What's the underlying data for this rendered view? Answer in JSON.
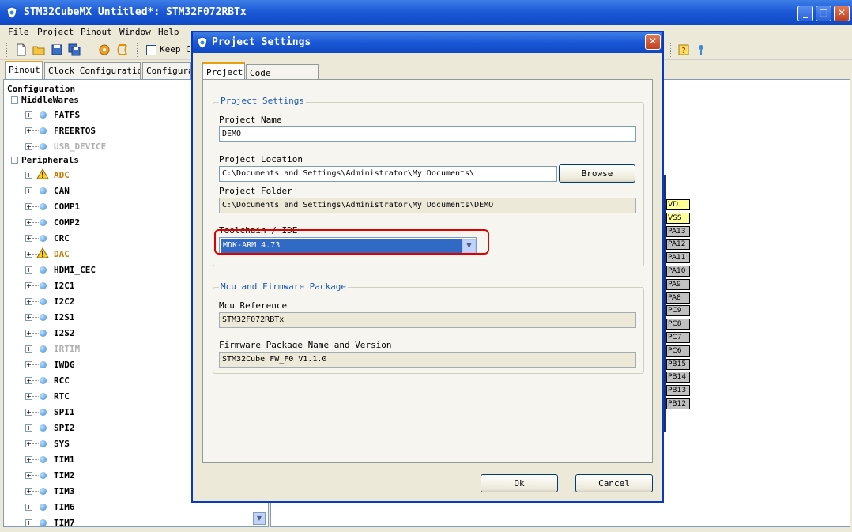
{
  "window": {
    "title": "STM32CubeMX Untitled*: STM32F072RBTx"
  },
  "menu": [
    "File",
    "Project",
    "Pinout",
    "Window",
    "Help"
  ],
  "toolbar": {
    "keep_label": "Keep Cu"
  },
  "main_tabs": [
    "Pinout",
    "Clock Configuration",
    "Configura"
  ],
  "tree": {
    "root": "Configuration",
    "groups": [
      {
        "label": "MiddleWares",
        "items": [
          {
            "label": "FATFS",
            "state": "normal"
          },
          {
            "label": "FREERTOS",
            "state": "normal"
          },
          {
            "label": "USB_DEVICE",
            "state": "disabled"
          }
        ]
      },
      {
        "label": "Peripherals",
        "items": [
          {
            "label": "ADC",
            "state": "warning"
          },
          {
            "label": "CAN",
            "state": "normal"
          },
          {
            "label": "COMP1",
            "state": "normal"
          },
          {
            "label": "COMP2",
            "state": "normal"
          },
          {
            "label": "CRC",
            "state": "normal"
          },
          {
            "label": "DAC",
            "state": "warning"
          },
          {
            "label": "HDMI_CEC",
            "state": "normal"
          },
          {
            "label": "I2C1",
            "state": "normal"
          },
          {
            "label": "I2C2",
            "state": "normal"
          },
          {
            "label": "I2S1",
            "state": "normal"
          },
          {
            "label": "I2S2",
            "state": "normal"
          },
          {
            "label": "IRTIM",
            "state": "disabled"
          },
          {
            "label": "IWDG",
            "state": "normal"
          },
          {
            "label": "RCC",
            "state": "normal"
          },
          {
            "label": "RTC",
            "state": "normal"
          },
          {
            "label": "SPI1",
            "state": "normal"
          },
          {
            "label": "SPI2",
            "state": "normal"
          },
          {
            "label": "SYS",
            "state": "normal"
          },
          {
            "label": "TIM1",
            "state": "normal"
          },
          {
            "label": "TIM2",
            "state": "normal"
          },
          {
            "label": "TIM3",
            "state": "normal"
          },
          {
            "label": "TIM6",
            "state": "normal"
          },
          {
            "label": "TIM7",
            "state": "normal"
          }
        ]
      }
    ]
  },
  "pins": [
    {
      "label": "VD..",
      "color": "#ffff99"
    },
    {
      "label": "VSS",
      "color": "#ffff99"
    },
    {
      "label": "PA13",
      "color": "#c0c0c0"
    },
    {
      "label": "PA12",
      "color": "#c0c0c0"
    },
    {
      "label": "PA11",
      "color": "#c0c0c0"
    },
    {
      "label": "PA10",
      "color": "#c0c0c0"
    },
    {
      "label": "PA9",
      "color": "#c0c0c0"
    },
    {
      "label": "PA8",
      "color": "#c0c0c0"
    },
    {
      "label": "PC9",
      "color": "#c0c0c0"
    },
    {
      "label": "PC8",
      "color": "#c0c0c0"
    },
    {
      "label": "PC7",
      "color": "#c0c0c0"
    },
    {
      "label": "PC6",
      "color": "#c0c0c0"
    },
    {
      "label": "PB15",
      "color": "#c0c0c0"
    },
    {
      "label": "PB14",
      "color": "#c0c0c0"
    },
    {
      "label": "PB13",
      "color": "#c0c0c0"
    },
    {
      "label": "PB12",
      "color": "#c0c0c0"
    }
  ],
  "dialog": {
    "title": "Project Settings",
    "tabs": [
      "Project",
      "Code Generator"
    ],
    "project_group": {
      "title": "Project Settings",
      "name_label": "Project Name",
      "name_value": "DEMO",
      "location_label": "Project Location",
      "location_value": "C:\\Documents and Settings\\Administrator\\My Documents\\",
      "browse_label": "Browse",
      "folder_label": "Project Folder",
      "folder_value": "C:\\Documents and Settings\\Administrator\\My Documents\\DEMO",
      "toolchain_label": "Toolchain / IDE",
      "toolchain_value": "MDK-ARM 4.73"
    },
    "mcu_group": {
      "title": "Mcu and Firmware Package",
      "mcu_label": "Mcu Reference",
      "mcu_value": "STM32F072RBTx",
      "fw_label": "Firmware Package Name and Version",
      "fw_value": "STM32Cube FW_F0 V1.1.0"
    },
    "ok_label": "Ok",
    "cancel_label": "Cancel"
  },
  "colors": {
    "highlight": "#e00000",
    "selection": "#316ac5",
    "group_title": "#1a57b0"
  }
}
